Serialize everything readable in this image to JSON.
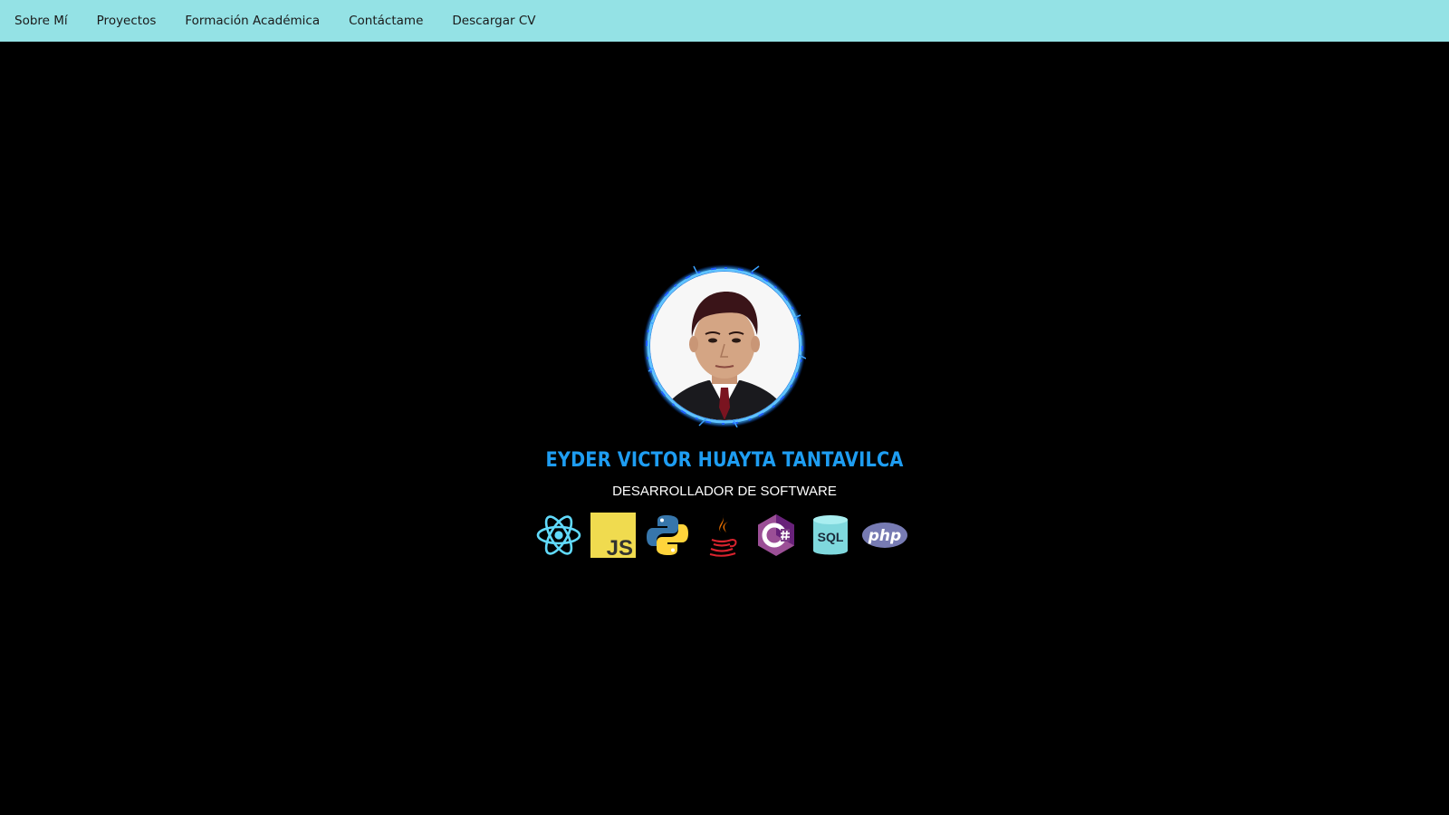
{
  "nav": {
    "items": [
      {
        "label": "Sobre Mí"
      },
      {
        "label": "Proyectos"
      },
      {
        "label": "Formación Académica"
      },
      {
        "label": "Contáctame"
      },
      {
        "label": "Descargar CV"
      }
    ]
  },
  "hero": {
    "name": "EYDER VICTOR HUAYTA TANTAVILCA",
    "role": "DESARROLLADOR DE SOFTWARE",
    "avatar_icon": "profile-photo",
    "tech_icons": [
      {
        "icon": "react-icon"
      },
      {
        "icon": "javascript-icon",
        "text": "JS"
      },
      {
        "icon": "python-icon"
      },
      {
        "icon": "java-icon"
      },
      {
        "icon": "csharp-icon"
      },
      {
        "icon": "sql-database-icon",
        "text": "SQL"
      },
      {
        "icon": "php-icon",
        "text": "php"
      }
    ]
  },
  "colors": {
    "navbar_bg": "#94e2e5",
    "page_bg": "#000000",
    "name_color": "#1e9df2",
    "role_color": "#ffffff"
  }
}
